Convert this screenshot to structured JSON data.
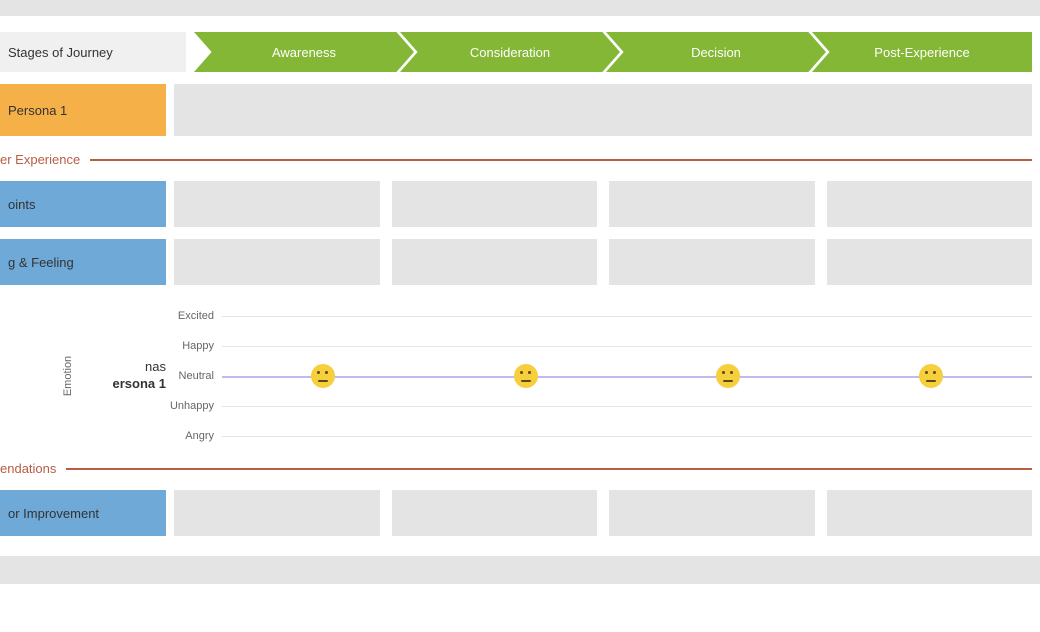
{
  "stages_of_journey_label": "Stages of Journey",
  "stages": [
    "Awareness",
    "Consideration",
    "Decision",
    "Post-Experience"
  ],
  "persona_row_label": "Persona 1",
  "sections": {
    "customer_experience": "er Experience",
    "recommendations": "endations"
  },
  "rows": {
    "touchpoints": "oints",
    "thinking_feeling": "g & Feeling",
    "areas_improvement": "or Improvement"
  },
  "emotion": {
    "axis_label": "Emotion",
    "persona_name_line1": "nas",
    "persona_name_line2": "ersona 1",
    "scale": [
      "Excited",
      "Happy",
      "Neutral",
      "Unhappy",
      "Angry"
    ]
  },
  "chart_data": {
    "type": "line",
    "title": "Emotion across journey stages",
    "xlabel": "",
    "ylabel": "Emotion",
    "categories": [
      "Awareness",
      "Consideration",
      "Decision",
      "Post-Experience"
    ],
    "y_categories": [
      "Angry",
      "Unhappy",
      "Neutral",
      "Happy",
      "Excited"
    ],
    "series": [
      {
        "name": "Persona 1",
        "values": [
          "Neutral",
          "Neutral",
          "Neutral",
          "Neutral"
        ]
      }
    ]
  },
  "colors": {
    "stage_green": "#83b735",
    "persona_orange": "#f6b048",
    "row_blue": "#6ea9d7",
    "section_rust": "#b85c44",
    "cell_grey": "#e4e4e4",
    "emotion_line": "#c6b8ea",
    "face_yellow": "#f7ce3c"
  }
}
